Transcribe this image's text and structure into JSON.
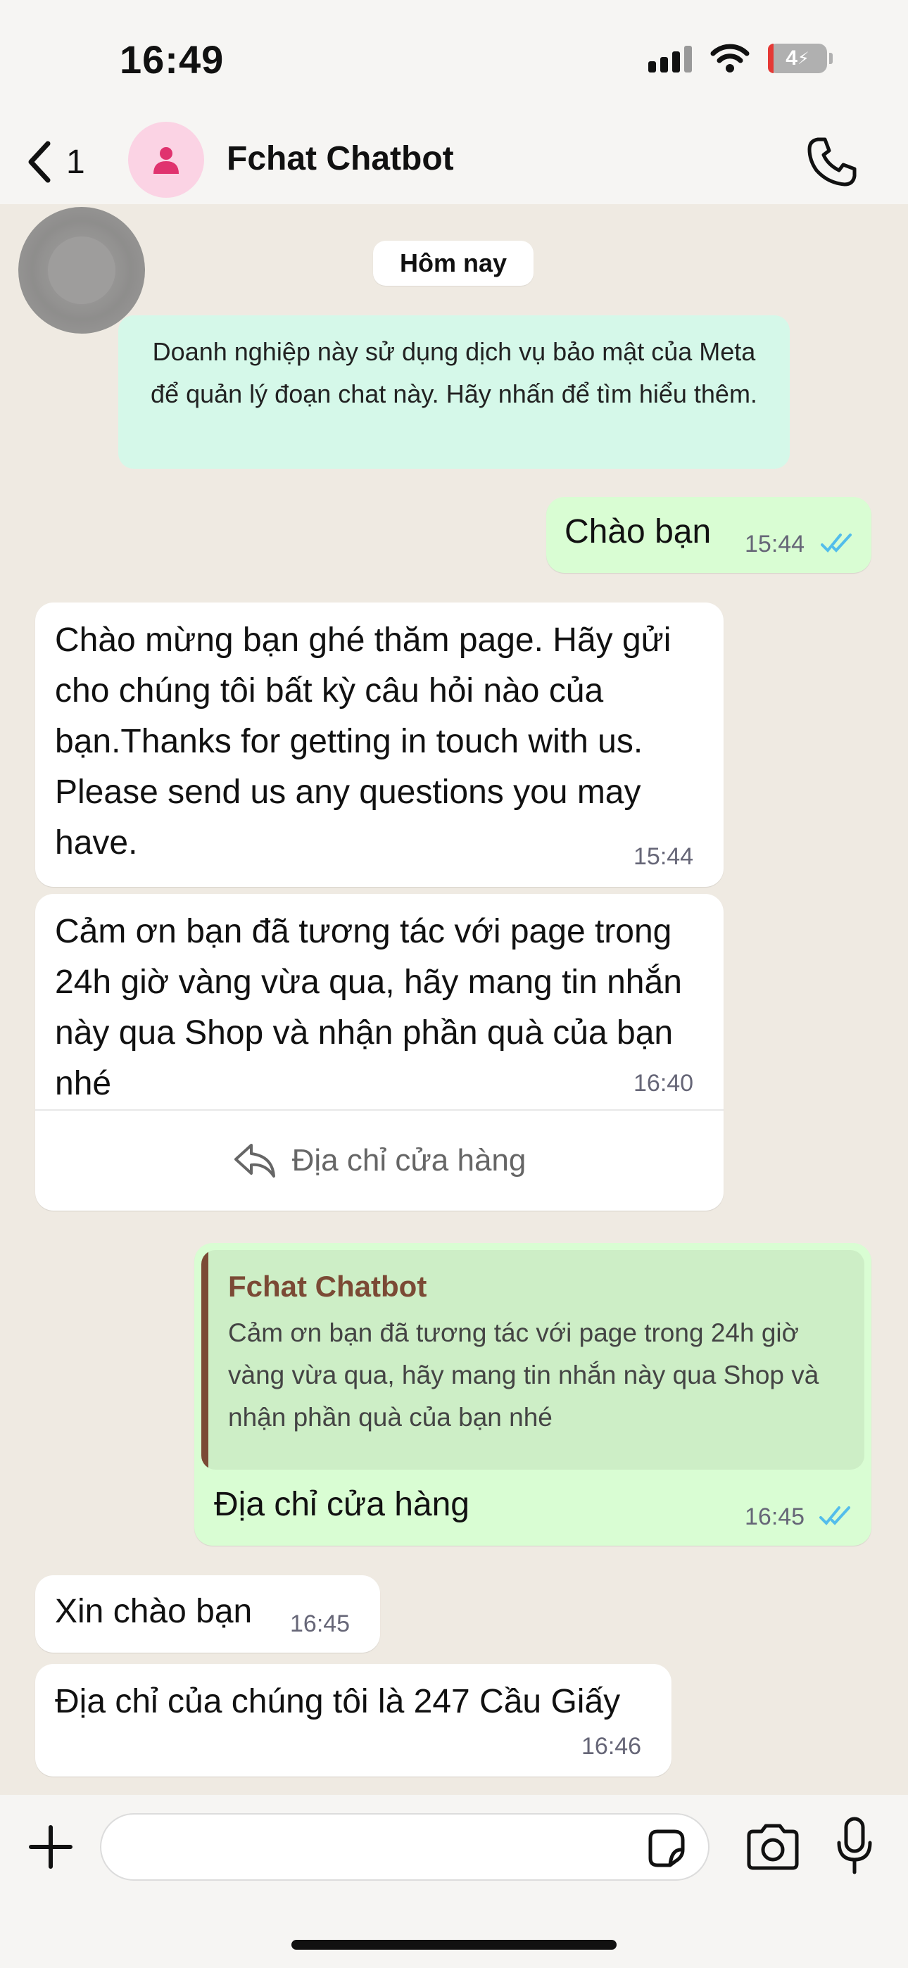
{
  "status_bar": {
    "time": "16:49",
    "battery": "4"
  },
  "header": {
    "back_count": "1",
    "contact_name": "Fchat Chatbot"
  },
  "chat": {
    "date_label": "Hôm nay",
    "info_notice": "Doanh nghiệp này sử dụng dịch vụ bảo mật của Meta để quản lý đoạn chat này. Hãy nhấn để tìm hiểu thêm.",
    "messages": [
      {
        "direction": "out",
        "text": "Chào bạn",
        "time": "15:44"
      },
      {
        "direction": "in",
        "text": "Chào mừng bạn ghé thăm page. Hãy gửi cho chúng tôi bất kỳ câu hỏi nào của bạn.Thanks for getting in touch with us. Please send us any questions you may have.",
        "time": "15:44"
      },
      {
        "direction": "in",
        "text": "Cảm ơn bạn đã tương tác với page trong 24h giờ vàng vừa qua, hãy mang tin nhắn này qua Shop và nhận phần quà của bạn nhé",
        "time": "16:40",
        "action_label": "Địa chỉ cửa hàng"
      },
      {
        "direction": "out",
        "quote_author": "Fchat Chatbot",
        "quote_text": "Cảm ơn bạn đã tương tác với page trong 24h giờ vàng vừa qua, hãy mang tin nhắn này qua Shop và nhận phần quà của bạn nhé",
        "text": "Địa chỉ cửa hàng",
        "time": "16:45"
      },
      {
        "direction": "in",
        "text": "Xin chào bạn",
        "time": "16:45"
      },
      {
        "direction": "in",
        "text": "Địa chỉ của chúng tôi là 247 Cầu Giấy",
        "time": "16:46"
      }
    ]
  },
  "colors": {
    "background": "#efeae2",
    "outgoing_bubble": "#d9fdd3",
    "incoming_bubble": "#ffffff",
    "info_bubble": "#d5f8e9",
    "read_ticks": "#53bdeb",
    "quote_accent": "#7b4a35",
    "avatar_bg": "#fbd3e4",
    "avatar_icon": "#e0336f"
  }
}
